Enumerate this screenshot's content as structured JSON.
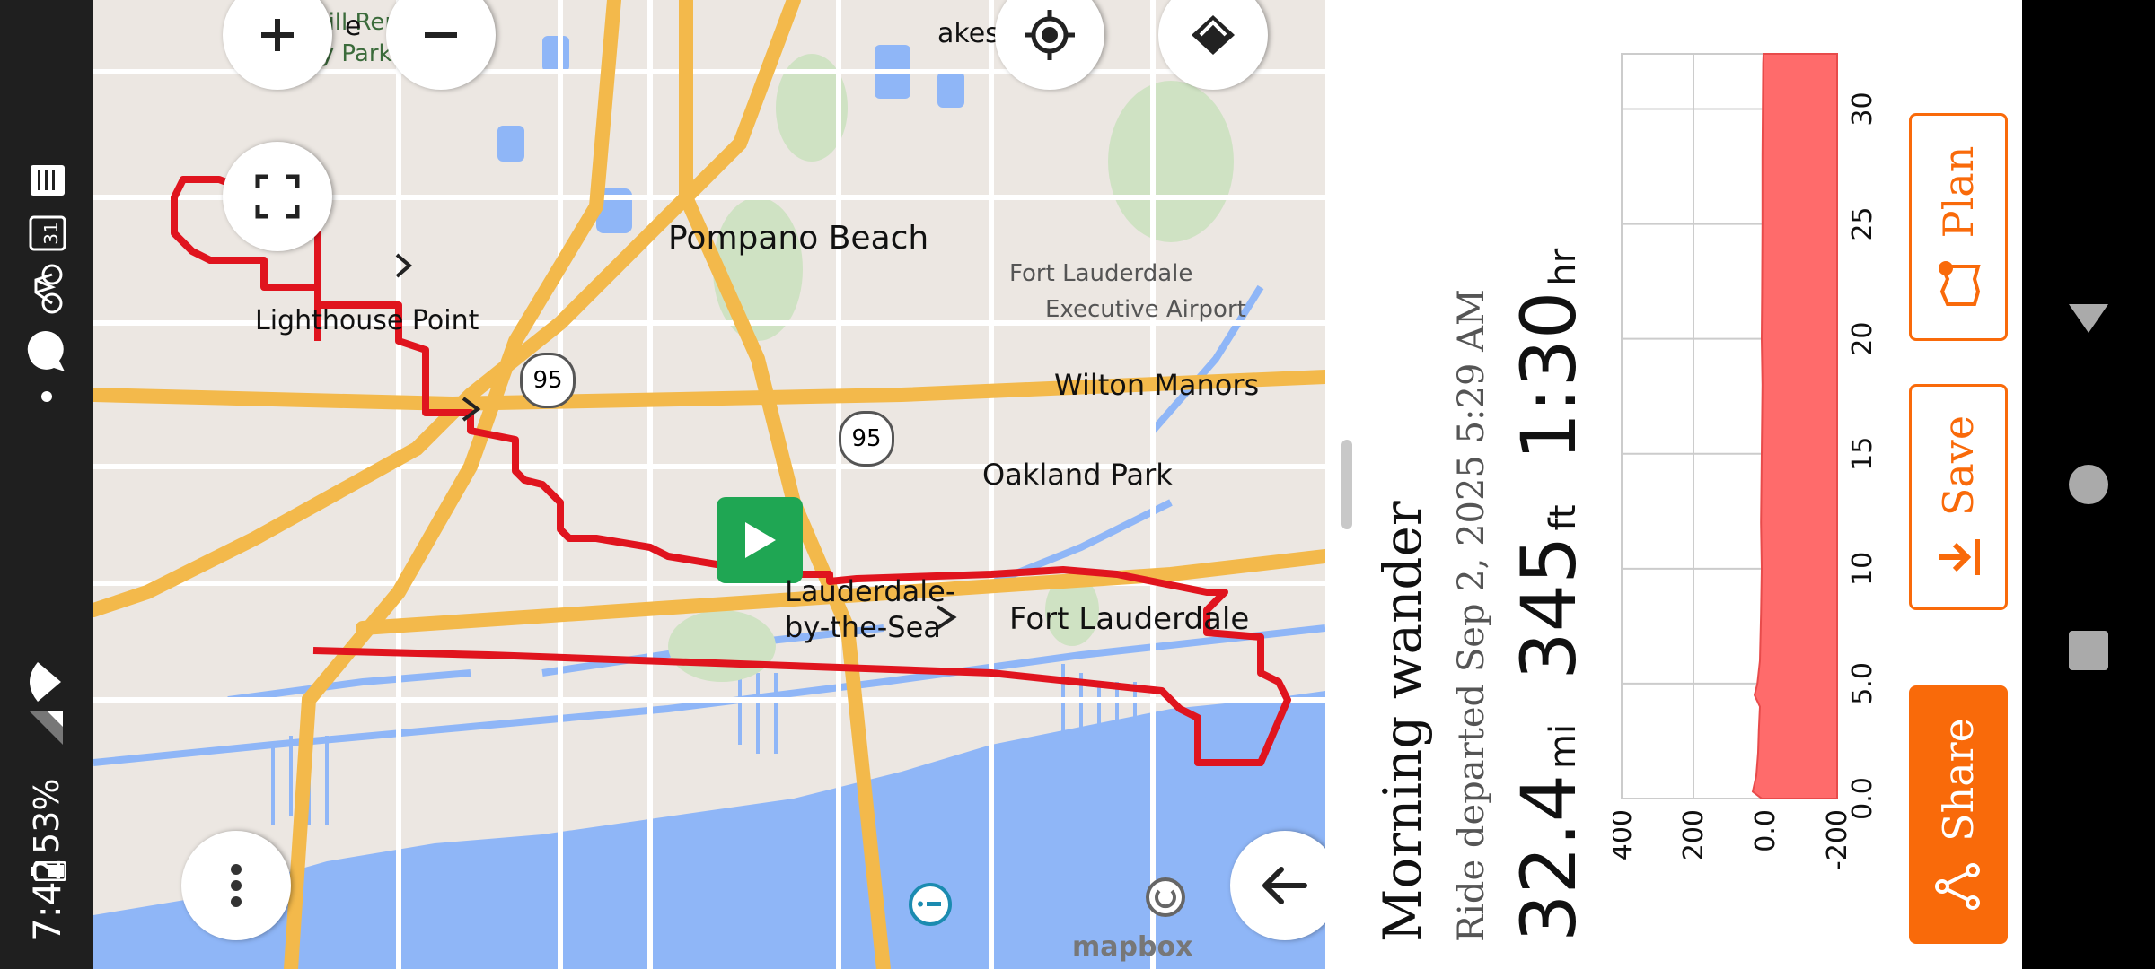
{
  "status_bar": {
    "time": "7:42",
    "battery_percent": "53%",
    "icons": [
      "battery-icon",
      "signal-icon",
      "wifi-icon",
      "dot-icon",
      "messages-icon",
      "bike-icon",
      "calendar-icon",
      "notes-icon"
    ]
  },
  "map": {
    "labels": {
      "fort_lauderdale": "Fort Lauderdale",
      "wilton_manors": "Wilton Manors",
      "oakland_park": "Oakland Park",
      "lauderdale_by_the_sea_1": "Lauderdale-",
      "lauderdale_by_the_sea_2": "by-the-Sea",
      "pompano_beach": "Pompano Beach",
      "lighthouse_point": "Lighthouse Point",
      "executive_airport_1": "Fort Lauderdale",
      "executive_airport_2": "Executive Airport",
      "renewable_park": "Mor  h Hill Renewable",
      "renewable_park_2": "ergy Park",
      "lakes": "akes",
      "e_label": "e",
      "highway_95_a": "95",
      "highway_95_b": "95",
      "attribution": "mapbox"
    },
    "buttons": {
      "layers": "layers-icon",
      "locate": "locate-icon",
      "zoom_out": "−",
      "zoom_in": "+",
      "fullscreen": "fullscreen-icon",
      "compass": "north-arrow-icon",
      "more": "more-icon"
    },
    "colors": {
      "route": "#e0141e",
      "water": "#8fb6f7",
      "land": "#ece7e2",
      "highway": "#f3b94b",
      "park": "#cfe2c3"
    }
  },
  "ride": {
    "title": "Morning wander",
    "subtitle": "Ride departed Sep 2, 2025 5:29 AM",
    "distance": "32.4",
    "distance_unit": "mi",
    "elevation": "345",
    "elevation_unit": "ft",
    "duration": "1:30",
    "duration_unit": "hr"
  },
  "chart_data": {
    "type": "area",
    "x_ticks": [
      "0.0",
      "5.0",
      "10",
      "15",
      "20",
      "25",
      "30"
    ],
    "y_ticks": [
      "400",
      "200",
      "0.0",
      "-200"
    ],
    "ylim": [
      -200,
      400
    ],
    "xlim": [
      0,
      32.4
    ],
    "series": [
      {
        "x": [
          0,
          0.3,
          1,
          2,
          3,
          4,
          4.5,
          5,
          6,
          8,
          10,
          12,
          15,
          18,
          20,
          22,
          25,
          28,
          30,
          32,
          32.4
        ],
        "values": [
          10,
          35,
          25,
          20,
          18,
          15,
          30,
          22,
          15,
          12,
          10,
          12,
          10,
          8,
          10,
          9,
          8,
          8,
          7,
          6,
          5
        ]
      }
    ],
    "color": "#ff6b6b"
  },
  "actions": {
    "share": "Share",
    "save": "Save",
    "plan": "Plan"
  },
  "nav": [
    "back-icon",
    "home-icon",
    "recents-icon"
  ]
}
